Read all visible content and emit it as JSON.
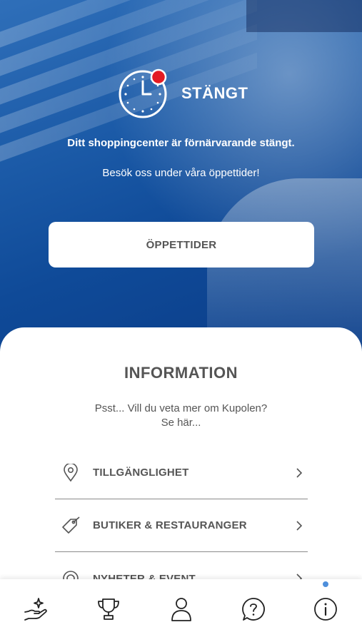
{
  "hero": {
    "status_label": "STÄNGT",
    "closed_message": "Ditt shoppingcenter är förnärvarande stängt.",
    "visit_message": "Besök oss under våra öppettider!",
    "hours_button_label": "ÖPPETTIDER",
    "status_dot_color": "#e31b23"
  },
  "info": {
    "title": "INFORMATION",
    "subtitle_line1": "Psst... Vill du veta mer om Kupolen?",
    "subtitle_line2": "Se här...",
    "items": [
      {
        "label": "TILLGÄNGLIGHET",
        "icon": "location-pin-icon"
      },
      {
        "label": "BUTIKER & RESTAURANGER",
        "icon": "price-tag-icon"
      },
      {
        "label": "NYHETER & EVENT",
        "icon": "target-icon"
      }
    ]
  },
  "tabbar": {
    "tabs": [
      {
        "icon": "hand-sparkle-icon",
        "active": false
      },
      {
        "icon": "trophy-icon",
        "active": false
      },
      {
        "icon": "person-icon",
        "active": false
      },
      {
        "icon": "question-bubble-icon",
        "active": false
      },
      {
        "icon": "info-circle-icon",
        "active": true
      }
    ],
    "active_color": "#4e8fdb"
  }
}
